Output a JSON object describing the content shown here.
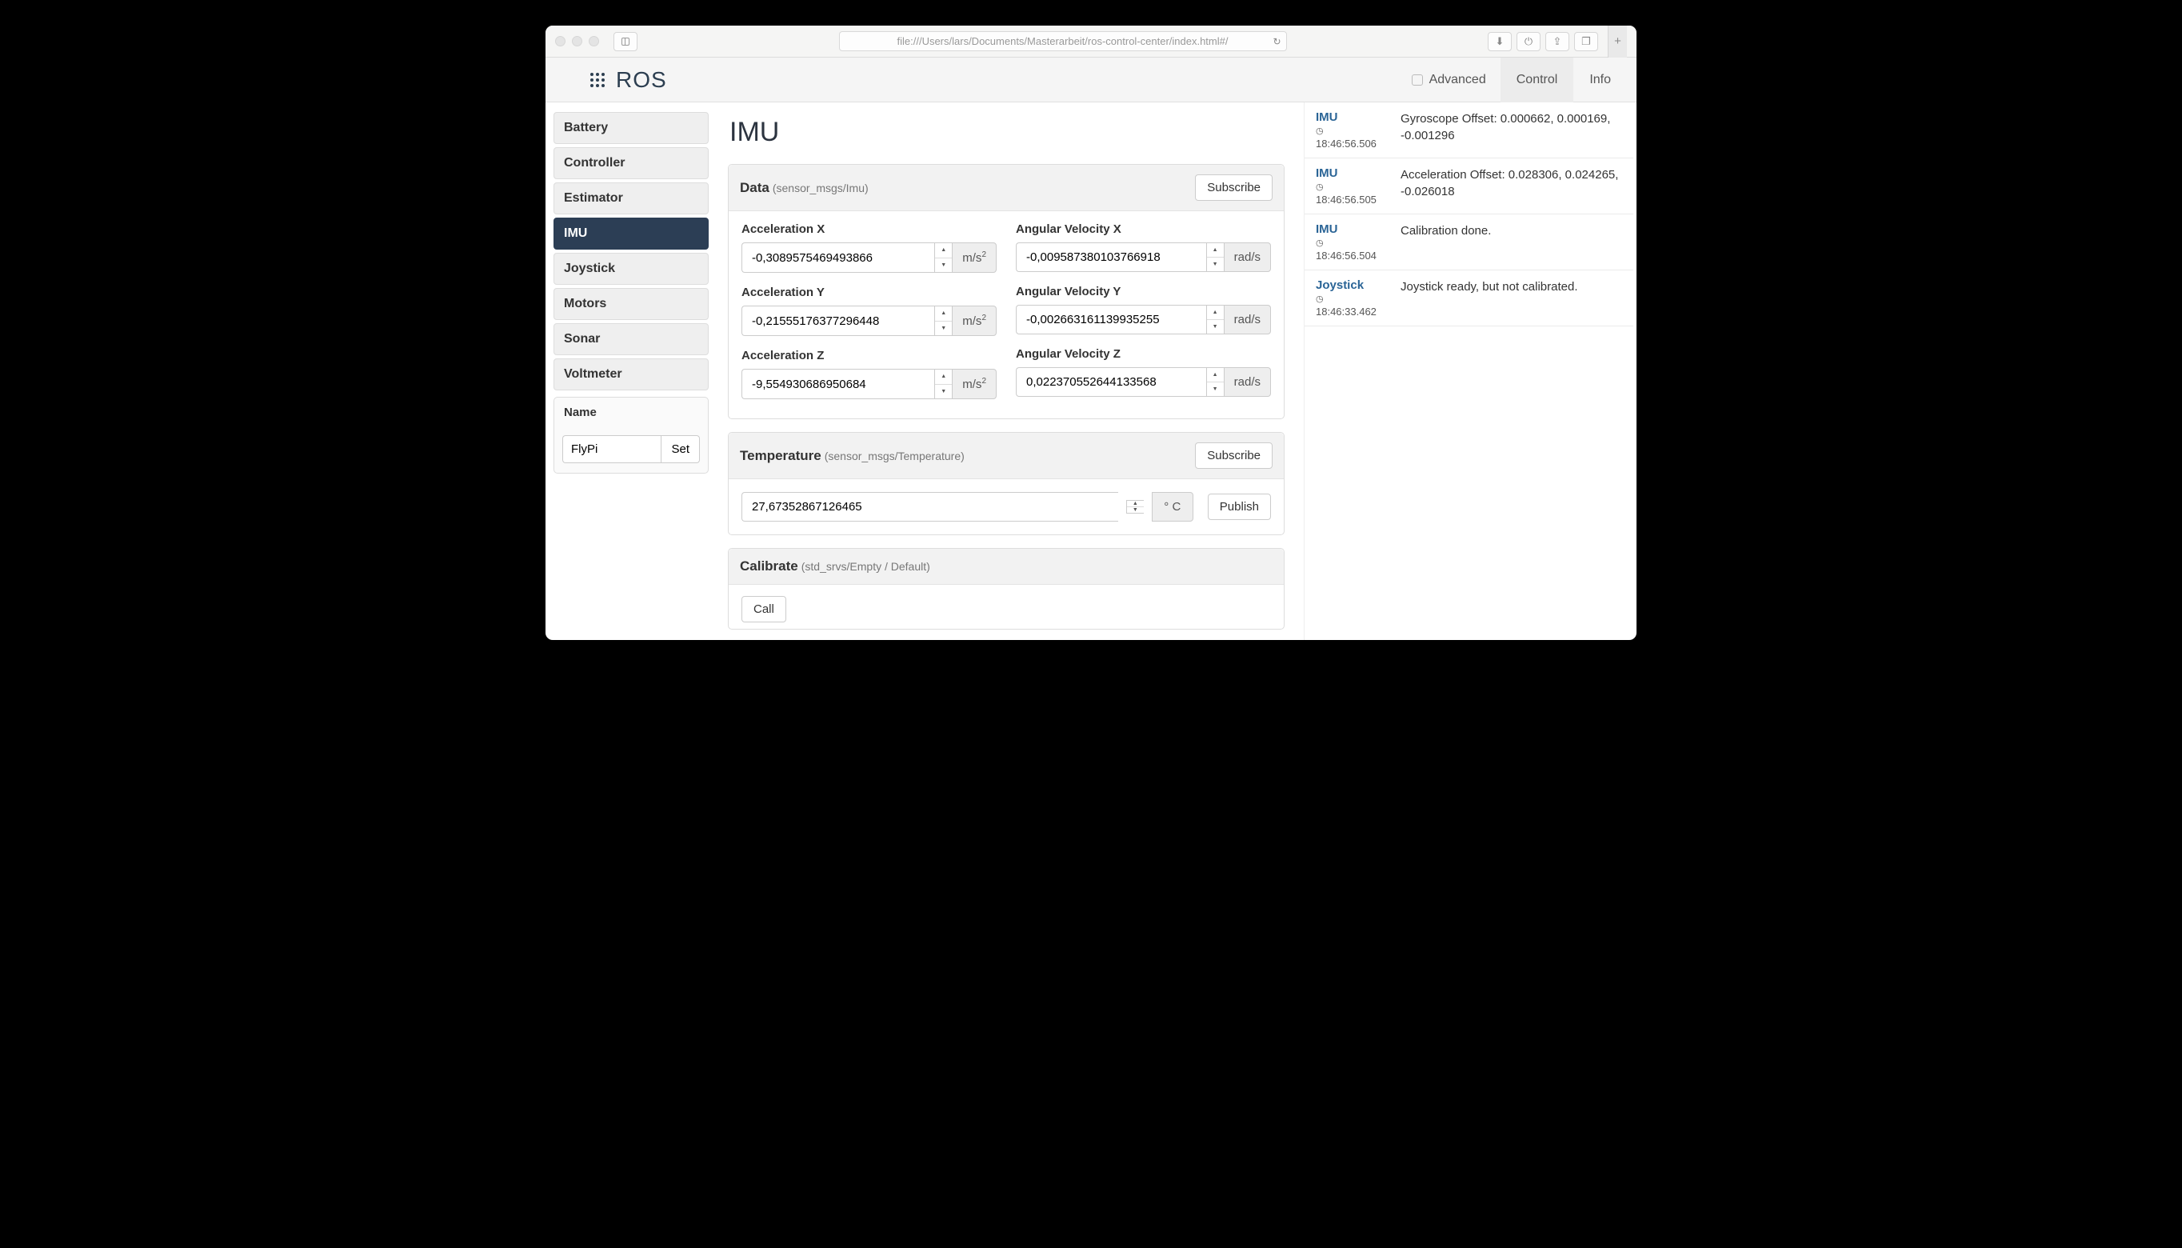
{
  "browser": {
    "url": "file:///Users/lars/Documents/Masterarbeit/ros-control-center/index.html#/"
  },
  "header": {
    "brand": "ROS",
    "advanced_label": "Advanced",
    "tabs": {
      "control": "Control",
      "info": "Info"
    }
  },
  "sidebar": {
    "items": [
      {
        "label": "Battery"
      },
      {
        "label": "Controller"
      },
      {
        "label": "Estimator"
      },
      {
        "label": "IMU"
      },
      {
        "label": "Joystick"
      },
      {
        "label": "Motors"
      },
      {
        "label": "Sonar"
      },
      {
        "label": "Voltmeter"
      }
    ],
    "name_panel": {
      "title": "Name",
      "value": "FlyPi",
      "set_label": "Set"
    }
  },
  "page": {
    "title": "IMU",
    "data_panel": {
      "title": "Data",
      "sub": "(sensor_msgs/Imu)",
      "subscribe": "Subscribe",
      "accel": {
        "x_label": "Acceleration X",
        "x_val": "-0,3089575469493866",
        "y_label": "Acceleration Y",
        "y_val": "-0,21555176377296448",
        "z_label": "Acceleration Z",
        "z_val": "-9,554930686950684",
        "unit_html": "m/s²"
      },
      "angvel": {
        "x_label": "Angular Velocity X",
        "x_val": "-0,009587380103766918",
        "y_label": "Angular Velocity Y",
        "y_val": "-0,002663161139935255",
        "z_label": "Angular Velocity Z",
        "z_val": "0,022370552644133568",
        "unit": "rad/s"
      }
    },
    "temp_panel": {
      "title": "Temperature",
      "sub": "(sensor_msgs/Temperature)",
      "subscribe": "Subscribe",
      "value": "27,67352867126465",
      "unit": "° C",
      "publish": "Publish"
    },
    "calib_panel": {
      "title": "Calibrate",
      "sub": "(std_srvs/Empty / Default)",
      "call": "Call"
    }
  },
  "log": [
    {
      "source": "IMU",
      "time": "18:46:56.506",
      "message": "Gyroscope Offset: 0.000662, 0.000169, -0.001296"
    },
    {
      "source": "IMU",
      "time": "18:46:56.505",
      "message": "Acceleration Offset: 0.028306, 0.024265, -0.026018"
    },
    {
      "source": "IMU",
      "time": "18:46:56.504",
      "message": "Calibration done."
    },
    {
      "source": "Joystick",
      "time": "18:46:33.462",
      "message": "Joystick ready, but not calibrated."
    }
  ]
}
